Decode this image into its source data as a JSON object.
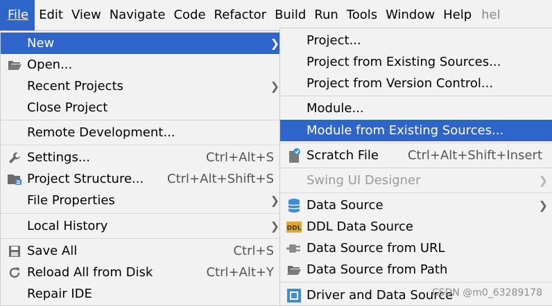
{
  "menubar": {
    "items": [
      {
        "label": "File"
      },
      {
        "label": "Edit"
      },
      {
        "label": "View"
      },
      {
        "label": "Navigate"
      },
      {
        "label": "Code"
      },
      {
        "label": "Refactor"
      },
      {
        "label": "Build"
      },
      {
        "label": "Run"
      },
      {
        "label": "Tools"
      },
      {
        "label": "Window"
      },
      {
        "label": "Help"
      },
      {
        "label": "hel"
      }
    ]
  },
  "file_menu": {
    "new": {
      "label": "New"
    },
    "open": {
      "label": "Open..."
    },
    "recent_projects": {
      "label": "Recent Projects"
    },
    "close_project": {
      "label": "Close Project"
    },
    "remote_development": {
      "label": "Remote Development..."
    },
    "settings": {
      "label": "Settings...",
      "shortcut": "Ctrl+Alt+S"
    },
    "project_structure": {
      "label": "Project Structure...",
      "shortcut": "Ctrl+Alt+Shift+S"
    },
    "file_properties": {
      "label": "File Properties"
    },
    "local_history": {
      "label": "Local History"
    },
    "save_all": {
      "label": "Save All",
      "shortcut": "Ctrl+S"
    },
    "reload_all": {
      "label": "Reload All from Disk",
      "shortcut": "Ctrl+Alt+Y"
    },
    "repair_ide": {
      "label": "Repair IDE"
    }
  },
  "new_menu": {
    "project": {
      "label": "Project..."
    },
    "project_existing": {
      "label": "Project from Existing Sources..."
    },
    "project_vcs": {
      "label": "Project from Version Control..."
    },
    "module": {
      "label": "Module..."
    },
    "module_existing": {
      "label": "Module from Existing Sources..."
    },
    "scratch_file": {
      "label": "Scratch File",
      "shortcut": "Ctrl+Alt+Shift+Insert"
    },
    "swing_ui": {
      "label": "Swing UI Designer"
    },
    "data_source": {
      "label": "Data Source"
    },
    "ddl_data_source": {
      "label": "DDL Data Source",
      "icon_text": "DDL"
    },
    "data_source_url": {
      "label": "Data Source from URL"
    },
    "data_source_path": {
      "label": "Data Source from Path"
    },
    "driver_data_source": {
      "label": "Driver and Data Source"
    }
  },
  "watermark": "CSDN @m0_63289178",
  "colors": {
    "selection": "#2f65ca",
    "menu_bg": "#f2f2f2",
    "icon_blue": "#3d8fd1"
  }
}
